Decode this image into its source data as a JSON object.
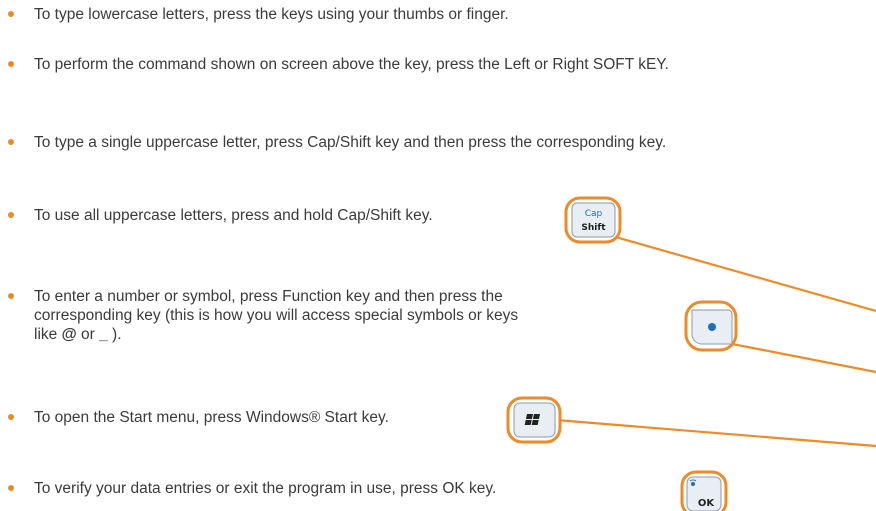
{
  "bullets": [
    {
      "text": "To type lowercase letters, press the keys using your thumbs or finger."
    },
    {
      "text": "To perform the command shown on screen above the key, press the Left or Right SOFT kEY."
    },
    {
      "text": "To type a single uppercase letter, press Cap/Shift key and then press the corresponding key."
    },
    {
      "text": "To use all uppercase letters, press and hold Cap/Shift key."
    },
    {
      "line1": "To enter a number or symbol, press Function key and then press the",
      "line2": "corresponding key (this is how you will access special symbols or keys",
      "line3_prefix": "like ",
      "symbol_at": "@",
      "or_word": " or ",
      "symbol_underscore": "_",
      "line3_suffix": " )."
    },
    {
      "text": "To open the Start menu, press Windows® Start key."
    },
    {
      "text": "To verify your data entries or exit the program in use, press OK key."
    }
  ],
  "keys": {
    "cap_shift": {
      "top": "Cap",
      "bottom": "Shift"
    },
    "ok": {
      "label": "OK"
    }
  },
  "colors": {
    "accent": "#f08a24",
    "text": "#3b3b3b",
    "key_face": "#e8eef3",
    "key_blue": "#1f6fb5"
  },
  "icons": [
    "cap-shift-key-icon",
    "function-key-icon",
    "windows-start-key-icon",
    "ok-key-icon"
  ]
}
